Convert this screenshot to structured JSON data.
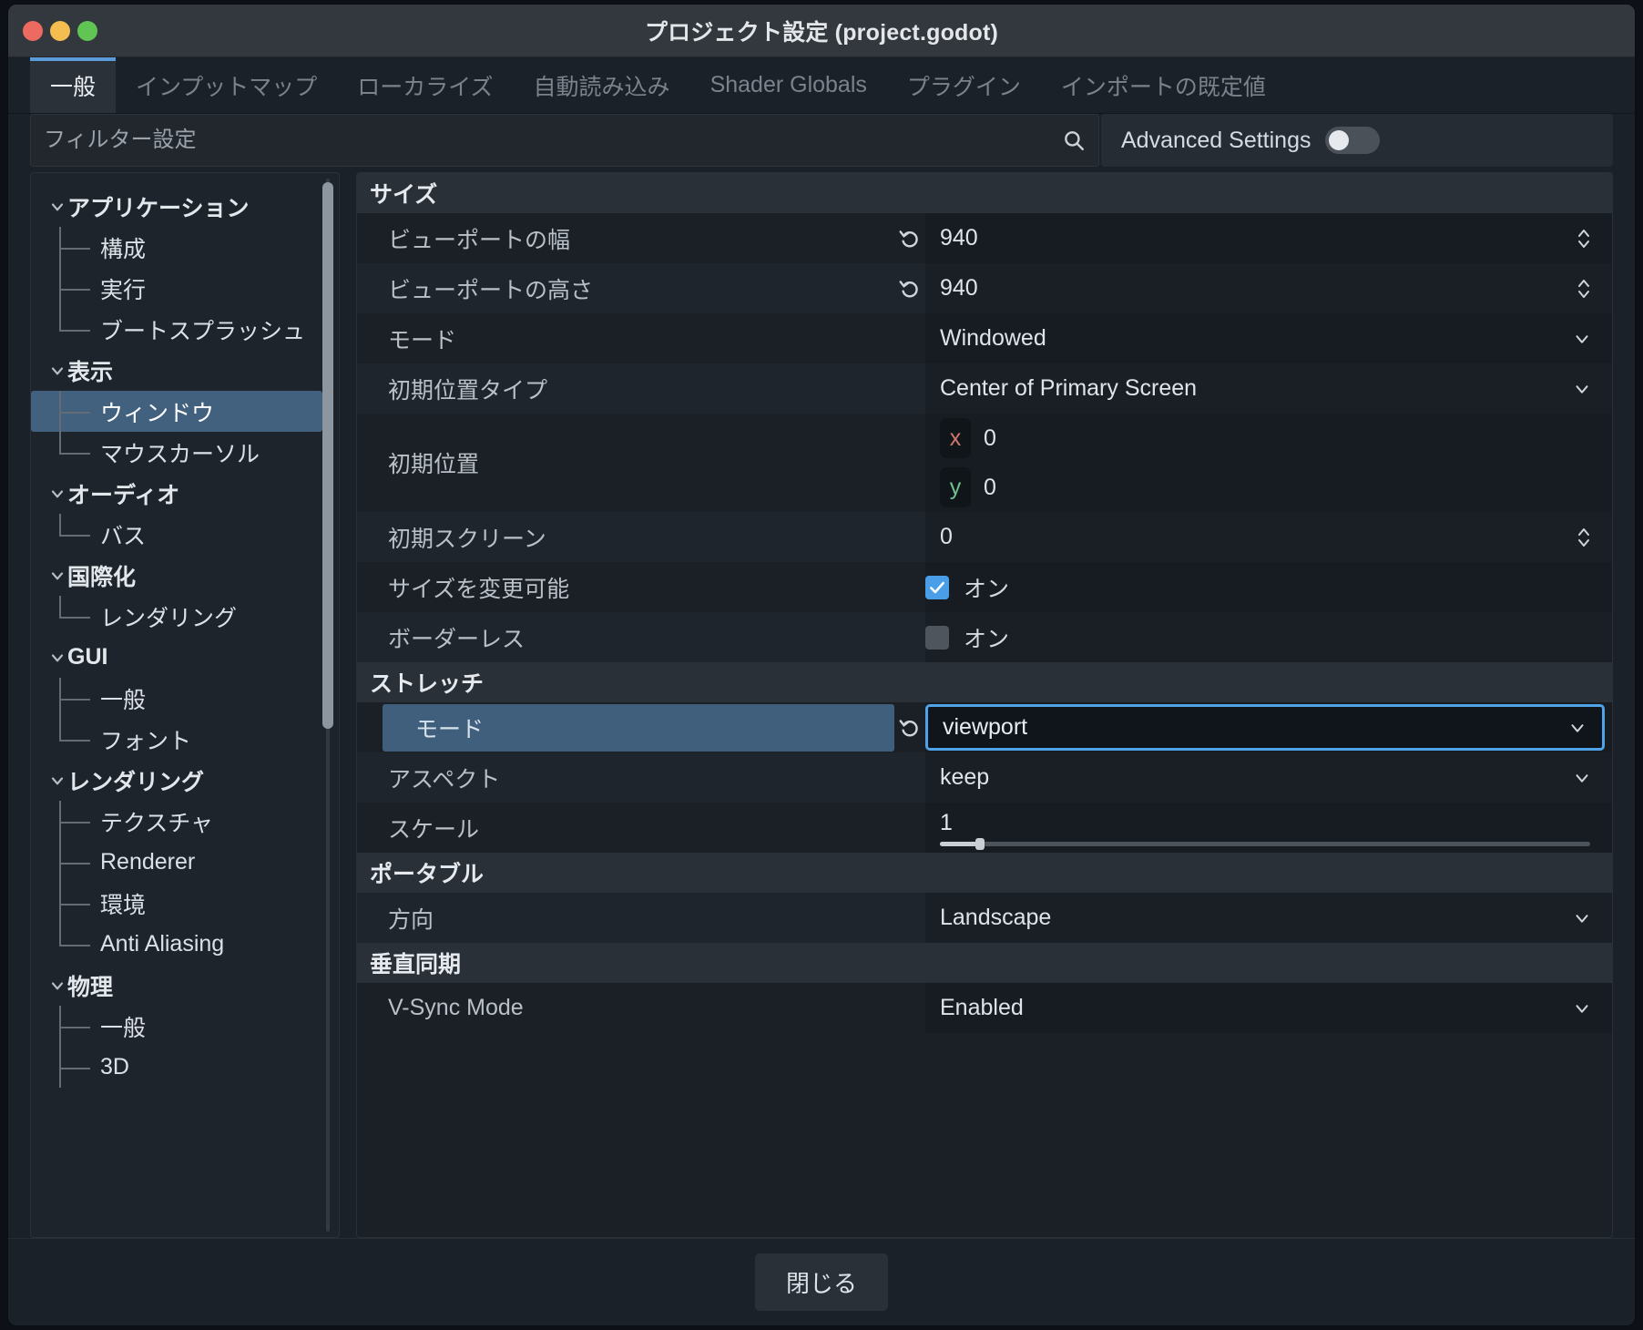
{
  "window": {
    "title": "プロジェクト設定 (project.godot)",
    "traffic_lights": [
      "close",
      "minimize",
      "maximize"
    ]
  },
  "tabs": [
    {
      "label": "一般",
      "active": true
    },
    {
      "label": "インプットマップ",
      "active": false
    },
    {
      "label": "ローカライズ",
      "active": false
    },
    {
      "label": "自動読み込み",
      "active": false
    },
    {
      "label": "Shader Globals",
      "active": false
    },
    {
      "label": "プラグイン",
      "active": false
    },
    {
      "label": "インポートの既定値",
      "active": false
    }
  ],
  "filter": {
    "placeholder": "フィルター設定",
    "value": "",
    "icon": "search-icon"
  },
  "advanced_settings": {
    "label": "Advanced Settings",
    "enabled": false
  },
  "sidebar": {
    "items": [
      {
        "label": "アプリケーション",
        "level": 0,
        "expanded": true,
        "selected": false
      },
      {
        "label": "構成",
        "level": 1,
        "selected": false,
        "last": false
      },
      {
        "label": "実行",
        "level": 1,
        "selected": false,
        "last": false
      },
      {
        "label": "ブートスプラッシュ",
        "level": 1,
        "selected": false,
        "last": true
      },
      {
        "label": "表示",
        "level": 0,
        "expanded": true,
        "selected": false
      },
      {
        "label": "ウィンドウ",
        "level": 1,
        "selected": true,
        "last": false
      },
      {
        "label": "マウスカーソル",
        "level": 1,
        "selected": false,
        "last": true
      },
      {
        "label": "オーディオ",
        "level": 0,
        "expanded": true,
        "selected": false
      },
      {
        "label": "バス",
        "level": 1,
        "selected": false,
        "last": true
      },
      {
        "label": "国際化",
        "level": 0,
        "expanded": true,
        "selected": false
      },
      {
        "label": "レンダリング",
        "level": 1,
        "selected": false,
        "last": true
      },
      {
        "label": "GUI",
        "level": 0,
        "expanded": true,
        "selected": false
      },
      {
        "label": "一般",
        "level": 1,
        "selected": false,
        "last": false
      },
      {
        "label": "フォント",
        "level": 1,
        "selected": false,
        "last": true
      },
      {
        "label": "レンダリング",
        "level": 0,
        "expanded": true,
        "selected": false
      },
      {
        "label": "テクスチャ",
        "level": 1,
        "selected": false,
        "last": false
      },
      {
        "label": "Renderer",
        "level": 1,
        "selected": false,
        "last": false
      },
      {
        "label": "環境",
        "level": 1,
        "selected": false,
        "last": false
      },
      {
        "label": "Anti Aliasing",
        "level": 1,
        "selected": false,
        "last": true
      },
      {
        "label": "物理",
        "level": 0,
        "expanded": true,
        "selected": false
      },
      {
        "label": "一般",
        "level": 1,
        "selected": false,
        "last": false
      },
      {
        "label": "3D",
        "level": 1,
        "selected": false,
        "last": false
      }
    ]
  },
  "settings": {
    "sections": [
      {
        "header": "サイズ",
        "rows": [
          {
            "name": "ビューポートの幅",
            "type": "number",
            "value": "940",
            "revert": true
          },
          {
            "name": "ビューポートの高さ",
            "type": "number",
            "value": "940",
            "revert": true
          },
          {
            "name": "モード",
            "type": "select",
            "value": "Windowed",
            "revert": false
          },
          {
            "name": "初期位置タイプ",
            "type": "select",
            "value": "Center of Primary Screen",
            "revert": false
          },
          {
            "name": "初期位置",
            "type": "vector2",
            "x_label": "x",
            "x_value": "0",
            "y_label": "y",
            "y_value": "0",
            "revert": false
          },
          {
            "name": "初期スクリーン",
            "type": "number",
            "value": "0",
            "revert": false
          },
          {
            "name": "サイズを変更可能",
            "type": "bool",
            "value": "オン",
            "checked": true,
            "revert": false
          },
          {
            "name": "ボーダーレス",
            "type": "bool",
            "value": "オン",
            "checked": false,
            "revert": false
          }
        ]
      },
      {
        "header": "ストレッチ",
        "rows": [
          {
            "name": "モード",
            "type": "select-focused",
            "value": "viewport",
            "revert": true,
            "selected": true
          },
          {
            "name": "アスペクト",
            "type": "select",
            "value": "keep",
            "revert": false
          },
          {
            "name": "スケール",
            "type": "slider",
            "value": "1",
            "fill_percent": 6,
            "revert": false
          }
        ]
      },
      {
        "header": "ポータブル",
        "rows": [
          {
            "name": "方向",
            "type": "select",
            "value": "Landscape",
            "revert": false
          }
        ]
      },
      {
        "header": "垂直同期",
        "rows": [
          {
            "name": "V-Sync Mode",
            "type": "select",
            "value": "Enabled",
            "revert": false
          }
        ]
      }
    ]
  },
  "footer": {
    "close_label": "閉じる"
  },
  "colors": {
    "accent": "#4fa3e8",
    "selection": "#41617f",
    "window_bg": "#1b2129",
    "panel_bg": "#1b2026",
    "axis_x": "#d4766a",
    "axis_y": "#6fc28e",
    "checkbox_on": "#4a9ee8"
  }
}
